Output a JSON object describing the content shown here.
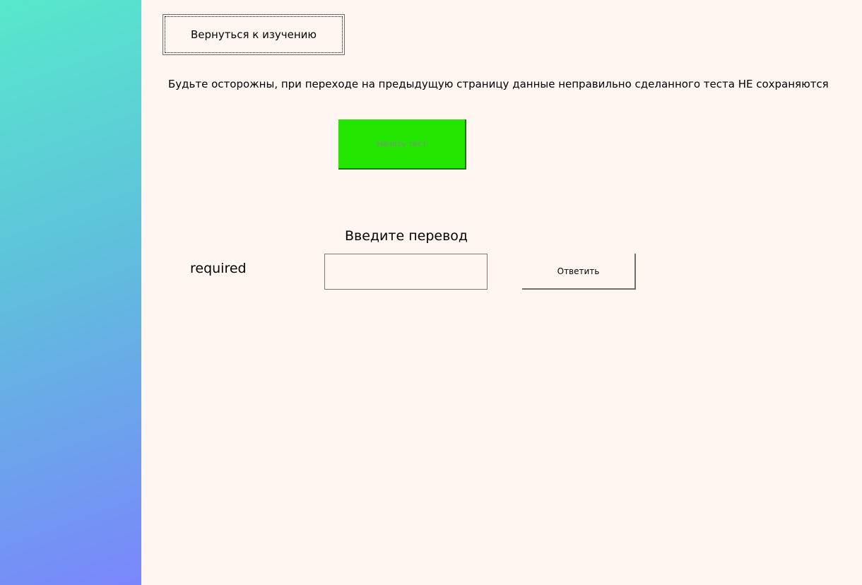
{
  "header": {
    "back_button_label": "Вернуться к изучению",
    "warning": "Будьте осторожны, при переходе на предыдущую страницу данные неправильно сделанного теста НЕ сохраняются"
  },
  "test": {
    "start_button_label": "Начать тест",
    "prompt": "Введите перевод",
    "word": "required",
    "answer_value": "",
    "submit_button_label": "Ответить"
  },
  "colors": {
    "background": "#fff6f1",
    "start_button": "#22e600",
    "sidebar_gradient_start": "#57e8cc",
    "sidebar_gradient_end": "#7a86fc"
  }
}
